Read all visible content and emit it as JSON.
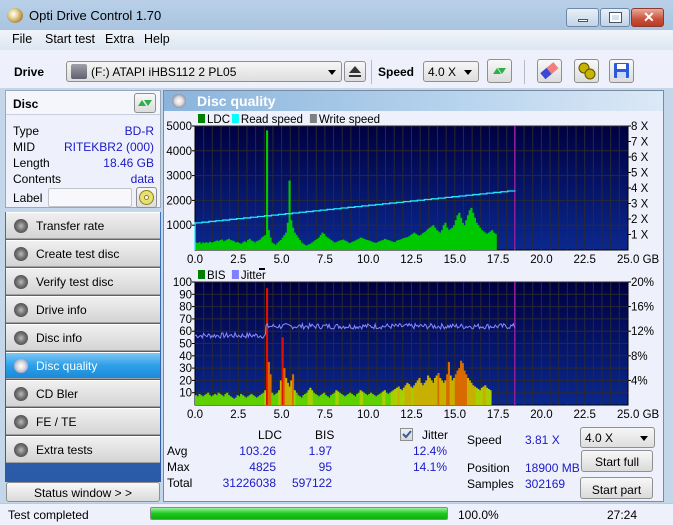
{
  "window": {
    "title": "Opti Drive Control 1.70"
  },
  "menu": [
    "File",
    "Start test",
    "Extra",
    "Help"
  ],
  "toolbar": {
    "drive_label": "Drive",
    "drive_value": "(F:)   ATAPI iHBS112   2 PL05",
    "speed_label": "Speed",
    "speed_value": "4.0 X"
  },
  "disc": {
    "title": "Disc",
    "fields": [
      {
        "key": "Type",
        "value": "BD-R"
      },
      {
        "key": "MID",
        "value": "RITEKBR2 (000)"
      },
      {
        "key": "Length",
        "value": "18.46 GB"
      },
      {
        "key": "Contents",
        "value": "data"
      }
    ],
    "label_key": "Label",
    "label_value": ""
  },
  "nav": [
    {
      "label": "Transfer rate",
      "active": false
    },
    {
      "label": "Create test disc",
      "active": false
    },
    {
      "label": "Verify test disc",
      "active": false
    },
    {
      "label": "Drive info",
      "active": false
    },
    {
      "label": "Disc info",
      "active": false
    },
    {
      "label": "Disc quality",
      "active": true
    },
    {
      "label": "CD Bler",
      "active": false
    },
    {
      "label": "FE / TE",
      "active": false
    },
    {
      "label": "Extra tests",
      "active": false
    }
  ],
  "status_window_label": "Status window > >",
  "panel_title": "Disc quality",
  "chart_data": [
    {
      "type": "bar",
      "title": "LDC / Read speed",
      "legend": [
        {
          "name": "LDC",
          "color": "#008000"
        },
        {
          "name": "Read speed",
          "color": "#00ffff"
        },
        {
          "name": "Write speed",
          "color": "#808080"
        }
      ],
      "legend_placement": "top-left",
      "xlabel": "GB",
      "xlim": [
        0,
        25
      ],
      "xticks": [
        "0.0",
        "2.5",
        "5.0",
        "7.5",
        "10.0",
        "12.5",
        "15.0",
        "17.5",
        "20.0",
        "22.5",
        "25.0 GB"
      ],
      "ylim": [
        0,
        5000
      ],
      "yticks": [
        "1000",
        "2000",
        "3000",
        "4000",
        "5000"
      ],
      "y2lim": [
        0,
        8
      ],
      "y2ticks": [
        "1 X",
        "2 X",
        "3 X",
        "4 X",
        "5 X",
        "6 X",
        "7 X",
        "8 X"
      ],
      "end_marker_gb": 18.46,
      "ldc_series": {
        "name": "LDC",
        "x_step_gb": 0.1,
        "values": [
          300,
          280,
          320,
          250,
          300,
          290,
          310,
          280,
          330,
          300,
          320,
          350,
          380,
          360,
          400,
          420,
          350,
          380,
          420,
          450,
          400,
          380,
          350,
          300,
          320,
          280,
          250,
          300,
          350,
          320,
          400,
          450,
          380,
          350,
          300,
          350,
          380,
          420,
          500,
          550,
          600,
          4825,
          800,
          500,
          300,
          250,
          200,
          280,
          350,
          400,
          500,
          600,
          700,
          1100,
          2800,
          1200,
          900,
          700,
          600,
          500,
          400,
          300,
          250,
          200,
          180,
          220,
          250,
          300,
          350,
          400,
          450,
          500,
          600,
          700,
          650,
          550,
          500,
          450,
          400,
          350,
          300,
          320,
          350,
          380,
          400,
          420,
          380,
          350,
          300,
          280,
          320,
          350,
          380,
          420,
          450,
          500,
          480,
          450,
          420,
          400,
          380,
          350,
          320,
          300,
          280,
          320,
          350,
          380,
          400,
          450,
          420,
          400,
          380,
          350,
          330,
          320,
          380,
          400,
          420,
          450,
          480,
          500,
          520,
          550,
          600,
          650,
          700,
          650,
          600,
          580,
          620,
          680,
          720,
          780,
          850,
          900,
          950,
          1000,
          900,
          800,
          750,
          700,
          800,
          1000,
          1100,
          900,
          800,
          850,
          900,
          1000,
          1200,
          1400,
          1500,
          1300,
          1100,
          1000,
          1200,
          1400,
          1600,
          1700,
          1500,
          1300,
          1100,
          1000,
          900,
          800,
          750,
          700,
          650,
          700,
          750,
          800,
          700,
          650
        ]
      },
      "read_speed_series": {
        "name": "Read speed",
        "start_x": 1.75,
        "end_x": 3.85,
        "unit": "X"
      }
    },
    {
      "type": "bar",
      "title": "BIS / Jitter",
      "legend": [
        {
          "name": "BIS",
          "color": "#008000"
        },
        {
          "name": "Jitter",
          "color": "#8080ff"
        }
      ],
      "legend_placement": "top-left",
      "xlabel": "GB",
      "xlim": [
        0,
        25
      ],
      "xticks": [
        "0.0",
        "2.5",
        "5.0",
        "7.5",
        "10.0",
        "12.5",
        "15.0",
        "17.5",
        "20.0",
        "22.5",
        "25.0 GB"
      ],
      "ylim": [
        0,
        100
      ],
      "yticks": [
        "10",
        "20",
        "30",
        "40",
        "50",
        "60",
        "70",
        "80",
        "90",
        "100"
      ],
      "y2lim": [
        0,
        20
      ],
      "y2ticks": [
        "4%",
        "8%",
        "12%",
        "16%",
        "20%"
      ],
      "end_marker_gb": 18.46,
      "bis_series": {
        "name": "BIS",
        "x_step_gb": 0.1,
        "values": [
          8,
          7,
          9,
          8,
          7,
          8,
          9,
          10,
          8,
          7,
          8,
          9,
          8,
          10,
          9,
          8,
          7,
          9,
          10,
          8,
          7,
          6,
          5,
          6,
          8,
          7,
          9,
          8,
          7,
          6,
          7,
          8,
          9,
          8,
          7,
          6,
          7,
          8,
          9,
          10,
          12,
          95,
          35,
          25,
          10,
          8,
          9,
          10,
          12,
          20,
          55,
          30,
          22,
          18,
          15,
          20,
          25,
          12,
          10,
          8,
          7,
          6,
          8,
          9,
          10,
          12,
          14,
          12,
          10,
          9,
          8,
          7,
          8,
          9,
          10,
          8,
          7,
          6,
          8,
          9,
          10,
          12,
          11,
          10,
          9,
          8,
          7,
          8,
          9,
          10,
          9,
          8,
          7,
          9,
          10,
          12,
          11,
          10,
          9,
          8,
          9,
          10,
          9,
          8,
          7,
          8,
          9,
          10,
          11,
          12,
          10,
          9,
          10,
          11,
          12,
          13,
          14,
          15,
          13,
          12,
          14,
          16,
          18,
          17,
          15,
          14,
          16,
          18,
          20,
          22,
          18,
          16,
          18,
          20,
          24,
          22,
          20,
          18,
          22,
          24,
          26,
          22,
          20,
          18,
          20,
          25,
          35,
          24,
          20,
          22,
          25,
          28,
          30,
          36,
          34,
          28,
          25,
          22,
          20,
          18,
          16,
          15,
          14,
          13,
          12,
          14,
          15,
          16,
          14,
          13,
          12
        ]
      },
      "jitter_series": {
        "name": "Jitter",
        "unit": "%",
        "segments": [
          {
            "from_gb": 0,
            "to_gb": 4.1,
            "value": 11.3
          },
          {
            "from_gb": 4.1,
            "to_gb": 18.46,
            "value": 12.8
          }
        ]
      }
    }
  ],
  "stats": {
    "col_ldc": "LDC",
    "col_bis": "BIS",
    "jitter_label": "Jitter",
    "jitter_checked": true,
    "rows": [
      {
        "label": "Avg",
        "ldc": "103.26",
        "bis": "1.97",
        "jitter": "12.4%"
      },
      {
        "label": "Max",
        "ldc": "4825",
        "bis": "95",
        "jitter": "14.1%"
      },
      {
        "label": "Total",
        "ldc": "31226038",
        "bis": "597122",
        "jitter": ""
      }
    ],
    "speed_label": "Speed",
    "speed_value": "3.81 X",
    "position_label": "Position",
    "position_value": "18900 MB",
    "samples_label": "Samples",
    "samples_value": "302169",
    "speed_select": "4.0 X",
    "start_full": "Start full",
    "start_part": "Start part"
  },
  "statusbar": {
    "text": "Test completed",
    "progress": 100.0,
    "progress_text": "100.0%",
    "time": "27:24"
  }
}
